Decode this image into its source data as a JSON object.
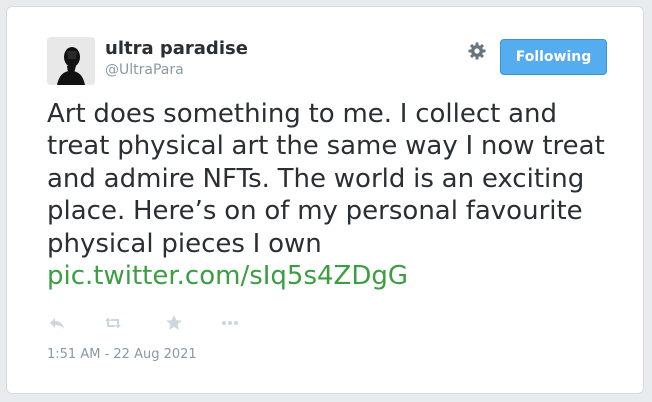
{
  "user": {
    "display_name": "ultra paradise",
    "handle": "@UltraPara"
  },
  "header": {
    "follow_label": "Following",
    "settings_icon": "gear-icon"
  },
  "tweet": {
    "text": "Art does something to me. I collect and treat physical art the same way I now treat and admire NFTs. The world is an exciting place. Here’s on of my personal favourite physical pieces I own",
    "link": "pic.twitter.com/sIq5s4ZDgG",
    "timestamp": "1:51 AM - 22 Aug 2021"
  },
  "actions": [
    {
      "name": "reply-icon"
    },
    {
      "name": "retweet-icon"
    },
    {
      "name": "favorite-icon"
    },
    {
      "name": "more-icon"
    }
  ],
  "colors": {
    "accent": "#55acee",
    "link": "#3b9e45",
    "text": "#292f33",
    "muted": "#8899a6"
  }
}
